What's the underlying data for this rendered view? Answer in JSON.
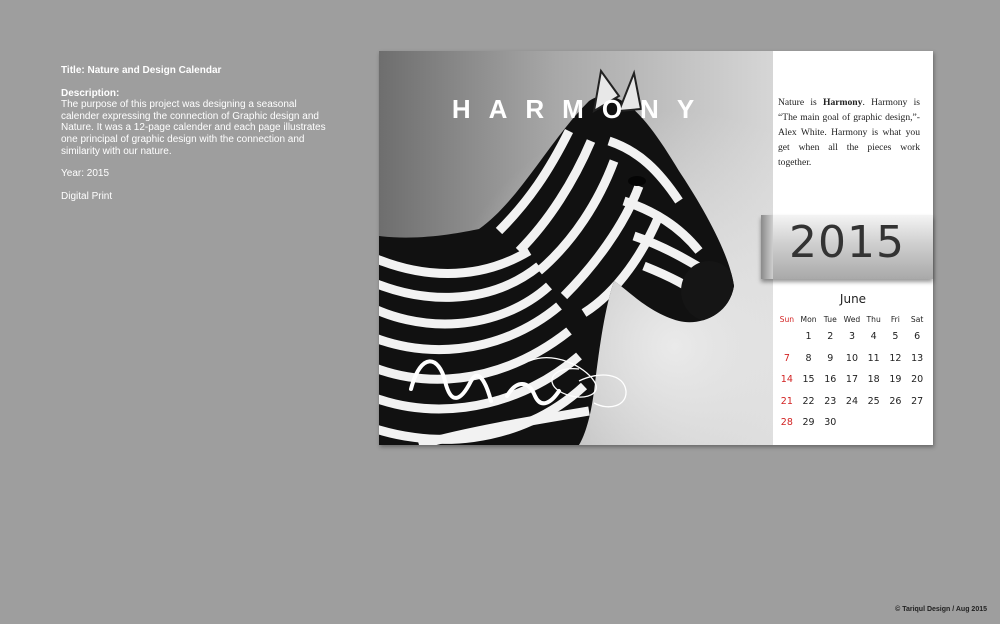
{
  "info": {
    "title": "Title: Nature and Design Calendar",
    "description_label": "Description:",
    "description": "The purpose of this project was designing a seasonal calender expressing the connection of Graphic design and Nature. It was a 12-page calender and each page illustrates one principal of graphic design with the connection and similarity with our nature.",
    "year": "Year: 2015",
    "medium": "Digital Print"
  },
  "calendar": {
    "headline": "HARMONY",
    "quote": {
      "part1": "Nature is ",
      "bold": "Harmony",
      "part2": ". Harmony is “The main goal of graphic design,”- Alex White. Harmony is what you get when all the pieces work together."
    },
    "year": "2015",
    "month": "June",
    "weekdays": [
      "Sun",
      "Mon",
      "Tue",
      "Wed",
      "Thu",
      "Fri",
      "Sat"
    ],
    "weeks": [
      [
        "",
        "1",
        "2",
        "3",
        "4",
        "5",
        "6"
      ],
      [
        "7",
        "8",
        "9",
        "10",
        "11",
        "12",
        "13"
      ],
      [
        "14",
        "15",
        "16",
        "17",
        "18",
        "19",
        "20"
      ],
      [
        "21",
        "22",
        "23",
        "24",
        "25",
        "26",
        "27"
      ],
      [
        "28",
        "29",
        "30",
        "",
        "",
        "",
        ""
      ]
    ],
    "sunday_color": "#d22222"
  },
  "footer": "© Tariqul Design / Aug 2015"
}
